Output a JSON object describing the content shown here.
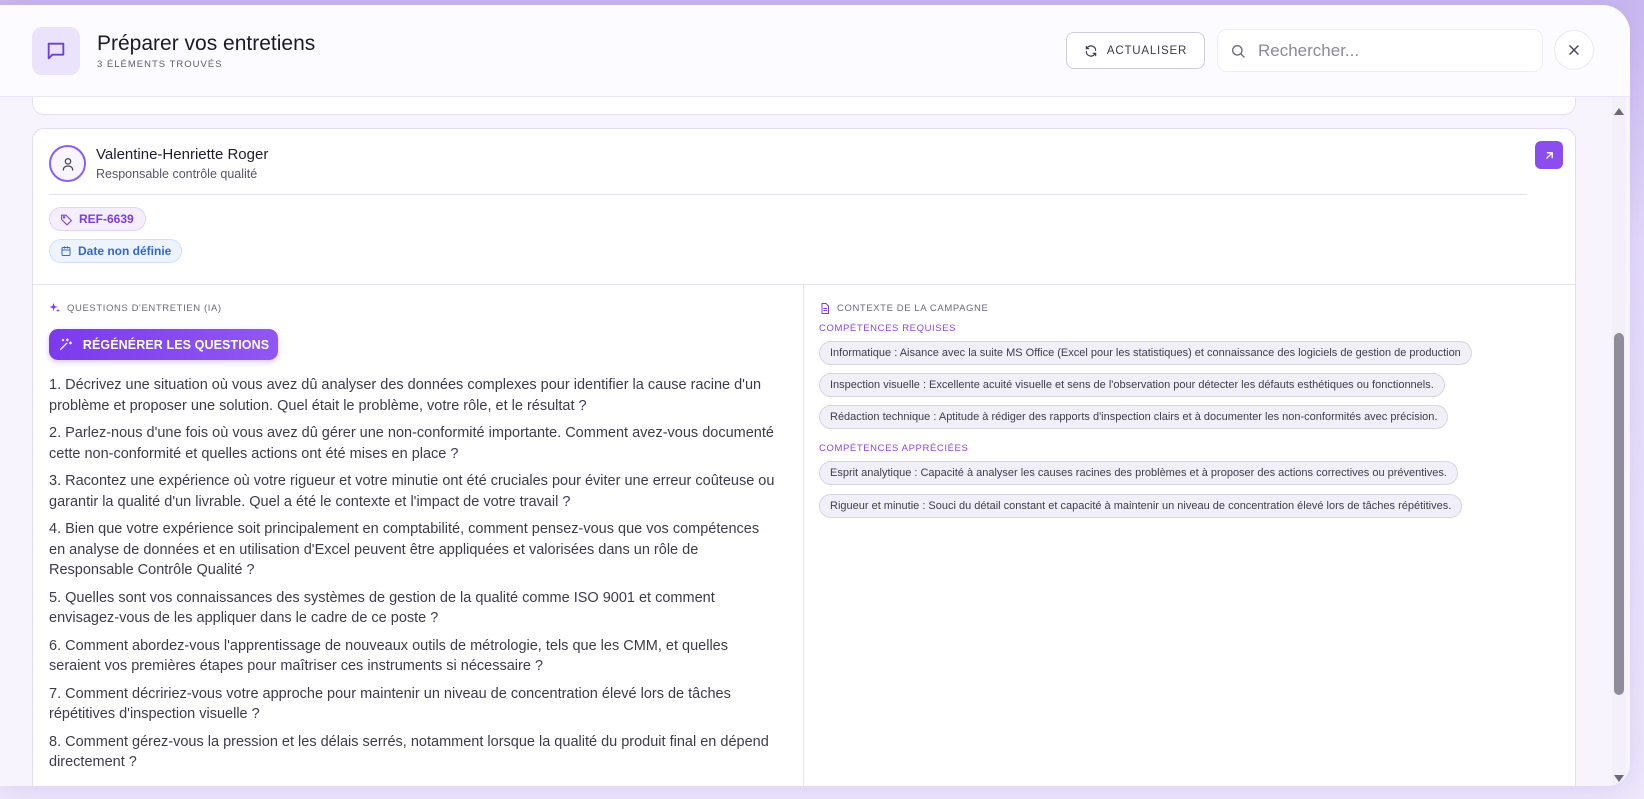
{
  "header": {
    "title": "Préparer vos entretiens",
    "subtitle": "3 ÉLÉMENTS TROUVÉS",
    "refresh_label": "ACTUALISER",
    "search_placeholder": "Rechercher..."
  },
  "candidate": {
    "name": "Valentine-Henriette Roger",
    "role": "Responsable contrôle qualité",
    "ref": "REF-6639",
    "date": "Date non définie"
  },
  "questions_section": {
    "label": "QUESTIONS D'ENTRETIEN (IA)",
    "regen_label": "RÉGÉNÉRER LES QUESTIONS",
    "questions": [
      "1. Décrivez une situation où vous avez dû analyser des données complexes pour identifier la cause racine d'un problème et proposer une solution. Quel était le problème, votre rôle, et le résultat ?",
      "2. Parlez-nous d'une fois où vous avez dû gérer une non-conformité importante. Comment avez-vous documenté cette non-conformité et quelles actions ont été mises en place ?",
      "3. Racontez une expérience où votre rigueur et votre minutie ont été cruciales pour éviter une erreur coûteuse ou garantir la qualité d'un livrable. Quel a été le contexte et l'impact de votre travail ?",
      "4. Bien que votre expérience soit principalement en comptabilité, comment pensez-vous que vos compétences en analyse de données et en utilisation d'Excel peuvent être appliquées et valorisées dans un rôle de Responsable Contrôle Qualité ?",
      "5. Quelles sont vos connaissances des systèmes de gestion de la qualité comme ISO 9001 et comment envisagez-vous de les appliquer dans le cadre de ce poste ?",
      "6. Comment abordez-vous l'apprentissage de nouveaux outils de métrologie, tels que les CMM, et quelles seraient vos premières étapes pour maîtriser ces instruments si nécessaire ?",
      "7. Comment décririez-vous votre approche pour maintenir un niveau de concentration élevé lors de tâches répétitives d'inspection visuelle ?",
      "8. Comment gérez-vous la pression et les délais serrés, notamment lorsque la qualité du produit final en dépend directement ?"
    ]
  },
  "context_section": {
    "label": "CONTEXTE DE LA CAMPAGNE",
    "required_label": "COMPÉTENCES REQUISES",
    "required": [
      "Informatique : Aisance avec la suite MS Office (Excel pour les statistiques) et connaissance des logiciels de gestion de production",
      "Inspection visuelle : Excellente acuité visuelle et sens de l'observation pour détecter les défauts esthétiques ou fonctionnels.",
      "Rédaction technique : Aptitude à rédiger des rapports d'inspection clairs et à documenter les non-conformités avec précision."
    ],
    "appreciated_label": "COMPÉTENCES APPRÉCIÉES",
    "appreciated": [
      "Esprit analytique : Capacité à analyser les causes racines des problèmes et à proposer des actions correctives ou préventives.",
      "Rigueur et minutie : Souci du détail constant et capacité à maintenir un niveau de concentration élevé lors de tâches répétitives."
    ]
  },
  "colors": {
    "accent": "#7c3aed",
    "date_chip": "#2f67d8"
  }
}
